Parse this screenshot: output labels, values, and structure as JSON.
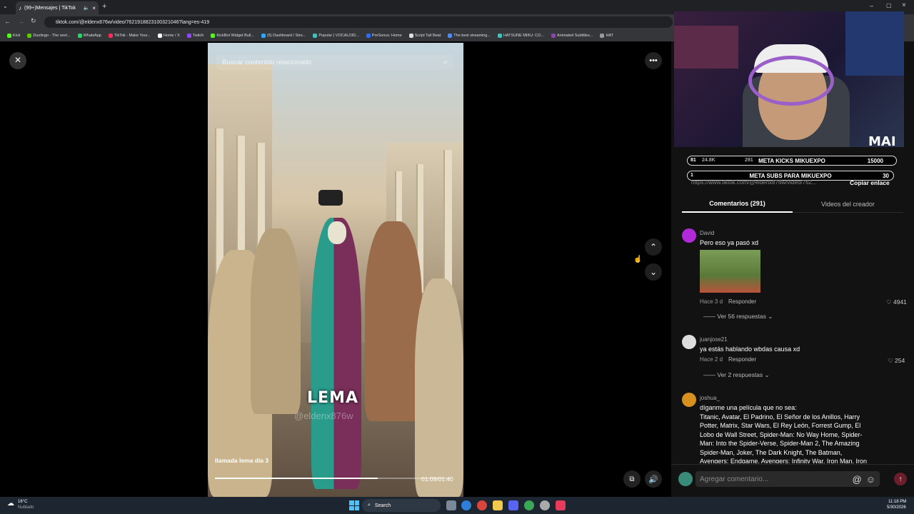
{
  "browser": {
    "tab_title": "(99+)Mensajes | TikTok",
    "url": "tiktok.com/@eldenx876w/video/7621918823100321046?lang=es-419",
    "bookmarks": [
      "Kick",
      "Duolingo - The worl...",
      "WhatsApp",
      "TikTok - Make Your...",
      "Home / X",
      "Twitch",
      "KickBot Widget Buil...",
      "(5) Dashboard / Stre...",
      "Popular | VOCALOID...",
      "PreSonus: Home",
      "Script Tail Beat",
      "The best streaming...",
      "HATSUNE MIKU: CO...",
      "Animated Subtitles...",
      "HAT"
    ]
  },
  "video": {
    "search_placeholder": "Buscar contenido relacionado",
    "caption": "LEMA",
    "watermark": "@eldenx876w",
    "title": "llamada lema día 3",
    "time": "01:09/01:40",
    "progress": 0.69
  },
  "stream_overlay": {
    "name": "MAI",
    "views": "24.8K",
    "comments": "291",
    "meta_kicks": "META KICKS MIKUEXPO",
    "kicks_left": "81",
    "kicks_goal": "15000",
    "meta_subs": "META SUBS PARA MIKUEXPO",
    "subs_left": "1",
    "subs_goal": "30",
    "share_url": "https://www.tiktok.com/@eldenx876w/video/762...",
    "copy_link": "Copiar enlace"
  },
  "panel": {
    "tab_comments": "Comentarios (291)",
    "tab_videos": "Videos del creador",
    "compose_placeholder": "Agregar comentario...",
    "comments": [
      {
        "user": "David",
        "text": "Pero eso ya pasó xd",
        "time": "Hace 3 d",
        "reply": "Responder",
        "likes": "4941",
        "more": "Ver 56 respuestas"
      },
      {
        "user": "juanjose21",
        "text": "ya estás hablando wbdas causa xd",
        "time": "Hace 2 d",
        "reply": "Responder",
        "likes": "254",
        "more": "Ver 2 respuestas"
      },
      {
        "user": "joshua_",
        "text_lines": [
          "díganme una película que no sea:",
          "Titanic, Avatar, El Padrino, El Señor de los Anillos, Harry",
          "Potter, Matrix, Star Wars, El Rey León, Forrest Gump, El",
          "Lobo de Wall Street, Spider-Man: No Way Home, Spider-",
          "Man: Into the Spider-Verse, Spider-Man 2, The Amazing",
          "Spider-Man, Joker, The Dark Knight, The Batman,",
          "Avengers: Endgame, Avengers: Infinity War, Iron Man, Iron"
        ]
      }
    ]
  },
  "taskbar": {
    "temp": "16°C",
    "weather": "Nublado",
    "search": "Search",
    "time": "11:18 PM",
    "date": "5/30/2026"
  },
  "colors": {
    "accent": "#fe2c55",
    "panel_bg": "#121212"
  }
}
